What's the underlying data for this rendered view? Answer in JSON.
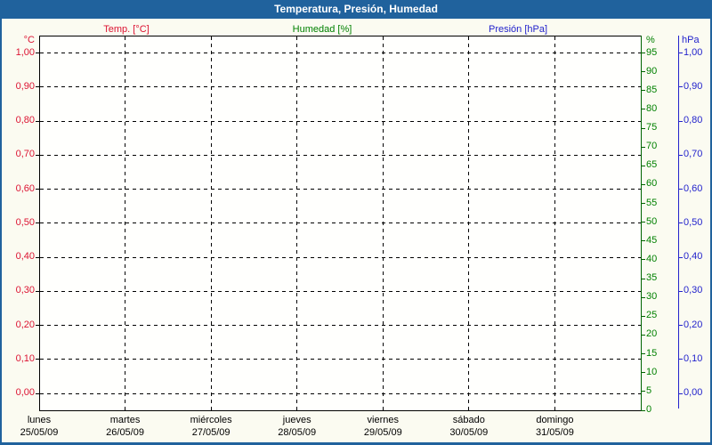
{
  "window": {
    "title": "Temperatura, Presión, Humedad"
  },
  "legend": {
    "items": [
      {
        "label": "Temp. [°C]",
        "series": "temperature"
      },
      {
        "label": "Humedad [%]",
        "series": "humidity"
      },
      {
        "label": "Presión [hPa]",
        "series": "pressure"
      }
    ]
  },
  "colors": {
    "titlebar_bg": "#20629d",
    "titlebar_text": "#ffffff",
    "frame": "#20629d",
    "panel_bg": "#fbfbf1",
    "plot_bg": "#fffffd",
    "grid": "#000000",
    "temperature": "#dc1432",
    "humidity": "#008000",
    "humidity_axis_line": "#006400",
    "pressure": "#2323cc",
    "x_label_text": "#000000"
  },
  "chart_data": {
    "type": "line",
    "title": "Temperatura, Presión, Humedad",
    "legend_position": "top",
    "grid": {
      "style": "dashed",
      "horizontal": "every 0,10 of the temperature/pressure scale",
      "vertical": "every day boundary"
    },
    "x_axis": {
      "days": [
        {
          "day": "lunes",
          "date": "25/05/09"
        },
        {
          "day": "martes",
          "date": "26/05/09"
        },
        {
          "day": "miércoles",
          "date": "27/05/09"
        },
        {
          "day": "jueves",
          "date": "28/05/09"
        },
        {
          "day": "viernes",
          "date": "29/05/09"
        },
        {
          "day": "sábado",
          "date": "30/05/09"
        },
        {
          "day": "domingo",
          "date": "31/05/09"
        }
      ]
    },
    "y_axes": {
      "temperature": {
        "unit": "°C",
        "side": "left",
        "range": [
          0,
          1
        ],
        "tick_labels": [
          "1,00",
          "0,90",
          "0,80",
          "0,70",
          "0,60",
          "0,50",
          "0,40",
          "0,30",
          "0,20",
          "0,10",
          "0,00"
        ]
      },
      "humidity": {
        "unit": "%",
        "side": "right_inner",
        "range": [
          0,
          95
        ],
        "tick_labels": [
          "95",
          "90",
          "85",
          "80",
          "75",
          "70",
          "65",
          "60",
          "55",
          "50",
          "45",
          "40",
          "35",
          "30",
          "25",
          "20",
          "15",
          "10",
          "5",
          "0"
        ]
      },
      "pressure": {
        "unit": "hPa",
        "side": "right_outer",
        "range": [
          0,
          1
        ],
        "tick_labels": [
          "1,00",
          "0,90",
          "0,80",
          "0,70",
          "0,60",
          "0,50",
          "0,40",
          "0,30",
          "0,20",
          "0,10",
          "0,00"
        ]
      }
    },
    "series": [
      {
        "name": "Temp. [°C]",
        "axis": "temperature",
        "values": []
      },
      {
        "name": "Humedad [%]",
        "axis": "humidity",
        "values": []
      },
      {
        "name": "Presión [hPa]",
        "axis": "pressure",
        "values": []
      }
    ],
    "note": "Plot area is empty — no data points are drawn in the screenshot."
  }
}
